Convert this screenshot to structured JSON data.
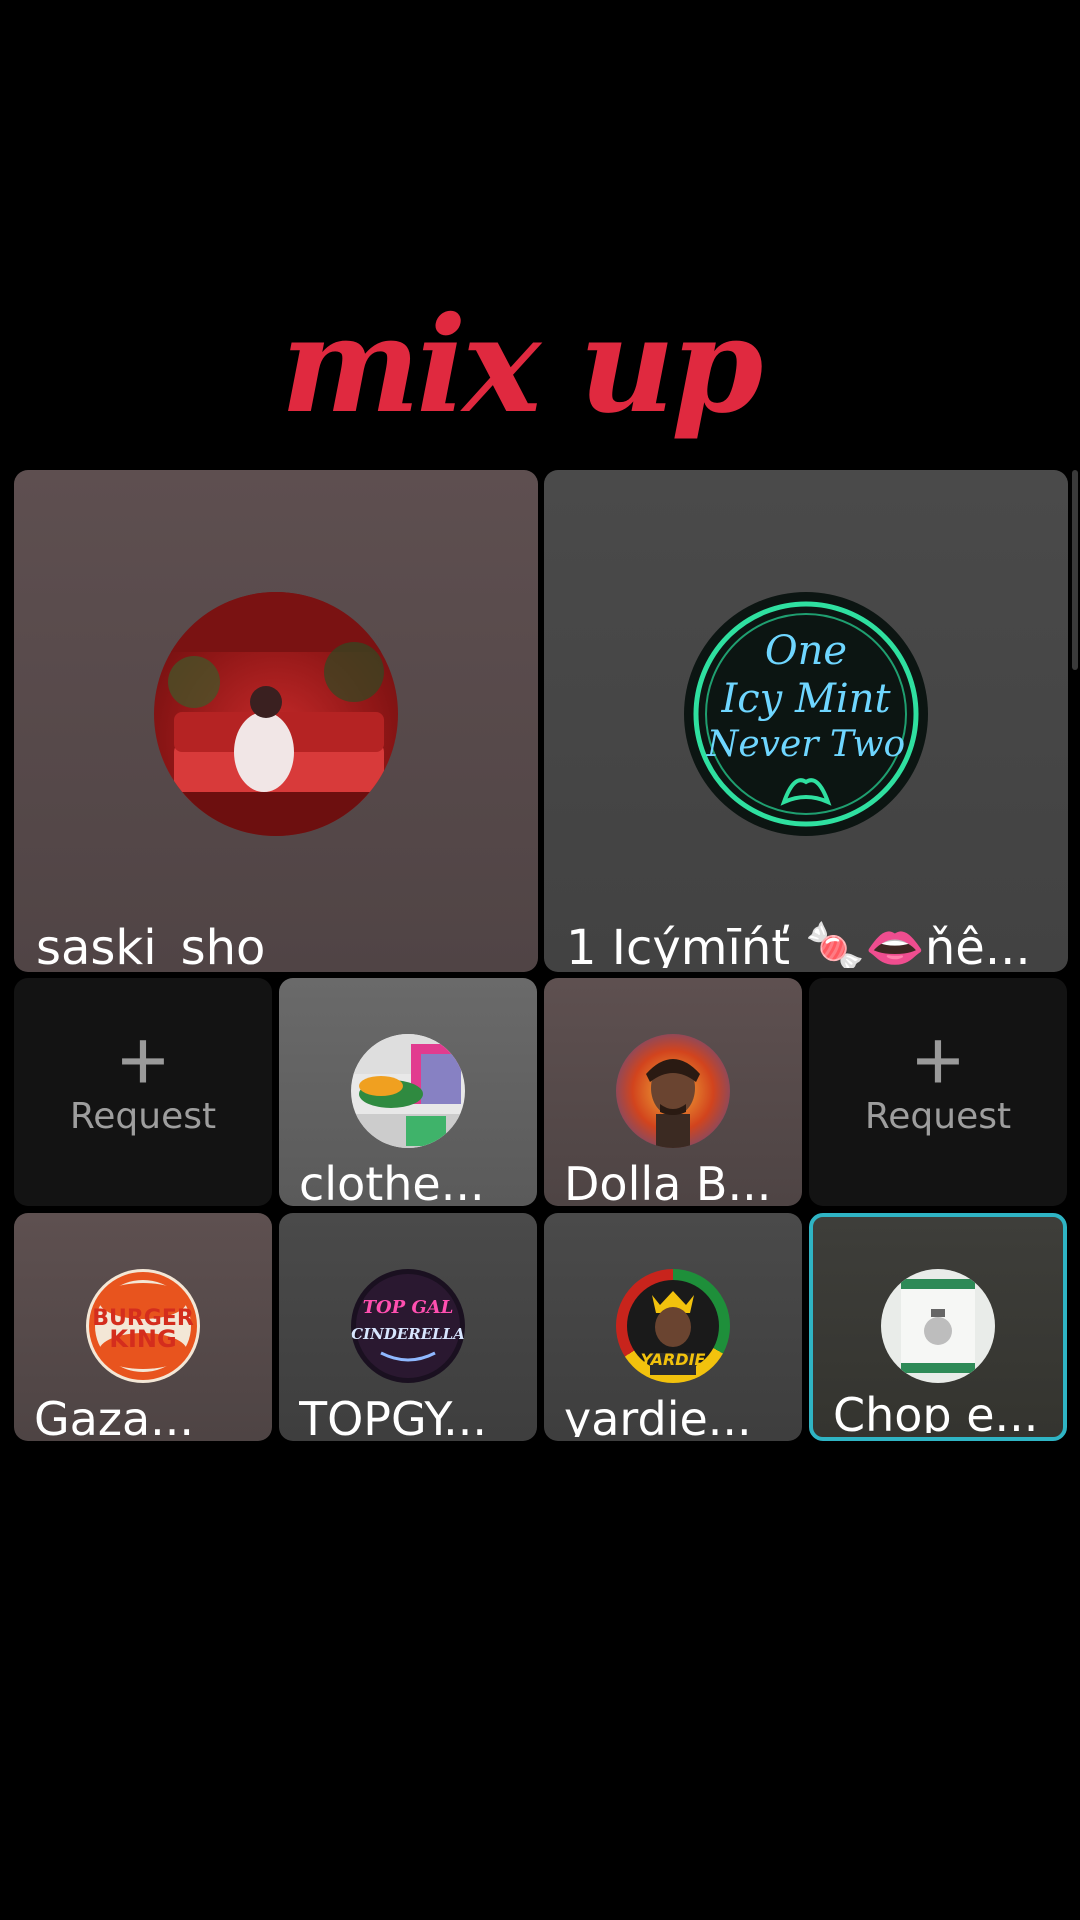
{
  "header": {
    "title": "mix up"
  },
  "big_tiles": [
    {
      "name": "saski_sho",
      "avatar_icon": "room-photo-avatar-icon"
    },
    {
      "name": "1 Icýmīńť 🍬👄ňê...",
      "avatar_icon": "neon-mint-logo-icon",
      "logo_text": [
        "One",
        "Icy Mint",
        "Never Two"
      ]
    }
  ],
  "row2": [
    {
      "type": "request",
      "label": "Request"
    },
    {
      "name": "clothe...",
      "avatar_icon": "sneakers-avatar-icon"
    },
    {
      "name": "Dolla B...",
      "avatar_icon": "portrait-avatar-icon"
    },
    {
      "type": "request",
      "label": "Request"
    }
  ],
  "row3": [
    {
      "name": "Gaza...",
      "avatar_icon": "burger-king-logo-icon",
      "logo_text": [
        "BURGER",
        "KING"
      ]
    },
    {
      "name": "TOPGY...",
      "avatar_icon": "topgal-cinderella-logo-icon",
      "logo_text": [
        "TOP GAL",
        "CINDERELLA"
      ]
    },
    {
      "name": "yardie...",
      "avatar_icon": "yardie-avatar-icon",
      "logo_text": [
        "YARDIE"
      ]
    },
    {
      "name": "Chop e...",
      "avatar_icon": "product-box-avatar-icon"
    }
  ],
  "colors": {
    "title": "#e0293f",
    "highlight_border": "#2fb4c4",
    "request_bg": "#131313"
  }
}
